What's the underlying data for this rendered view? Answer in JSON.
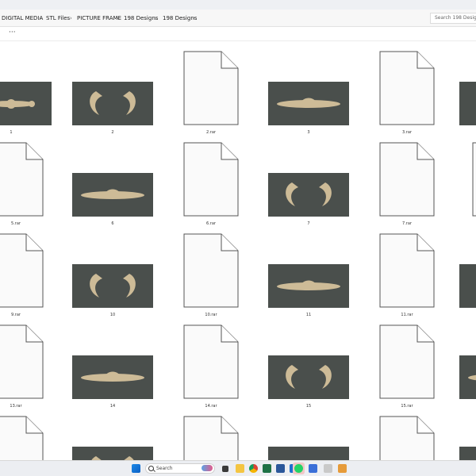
{
  "breadcrumb": [
    "DIGITAL MEDIA",
    "STL Files",
    "PICTURE FRAME",
    "198 Designs",
    "198 Designs"
  ],
  "search": {
    "placeholder": "Search 198 Designs"
  },
  "toolbar": {
    "more_label": "···"
  },
  "files": [
    {
      "caption": "1",
      "kind": "image"
    },
    {
      "caption": "2",
      "kind": "image"
    },
    {
      "caption": "2.rar",
      "kind": "doc"
    },
    {
      "caption": "3",
      "kind": "image"
    },
    {
      "caption": "3.rar",
      "kind": "doc"
    },
    {
      "caption": "5.rar",
      "kind": "doc"
    },
    {
      "caption": "6",
      "kind": "image"
    },
    {
      "caption": "6.rar",
      "kind": "doc"
    },
    {
      "caption": "7",
      "kind": "image"
    },
    {
      "caption": "7.rar",
      "kind": "doc"
    },
    {
      "caption": "9.rar",
      "kind": "doc"
    },
    {
      "caption": "10",
      "kind": "image"
    },
    {
      "caption": "10.rar",
      "kind": "doc"
    },
    {
      "caption": "11",
      "kind": "image"
    },
    {
      "caption": "11.rar",
      "kind": "doc"
    },
    {
      "caption": "13.rar",
      "kind": "doc"
    },
    {
      "caption": "14",
      "kind": "image"
    },
    {
      "caption": "14.rar",
      "kind": "doc"
    },
    {
      "caption": "15",
      "kind": "image"
    },
    {
      "caption": "15.rar",
      "kind": "doc"
    }
  ],
  "taskbar": {
    "search_label": "Search",
    "icons": [
      "windows-start-icon",
      "search-icon",
      "weather-widget-icon",
      "task-view-icon",
      "file-explorer-icon",
      "chrome-icon",
      "excel-icon",
      "word-icon",
      "outlook-icon",
      "whatsapp-icon",
      "photos-icon",
      "app-icon"
    ]
  },
  "colors": {
    "thumb_bg": "#4a4f4c",
    "ornament": "#cdbb97",
    "accent": "#0067c0"
  }
}
